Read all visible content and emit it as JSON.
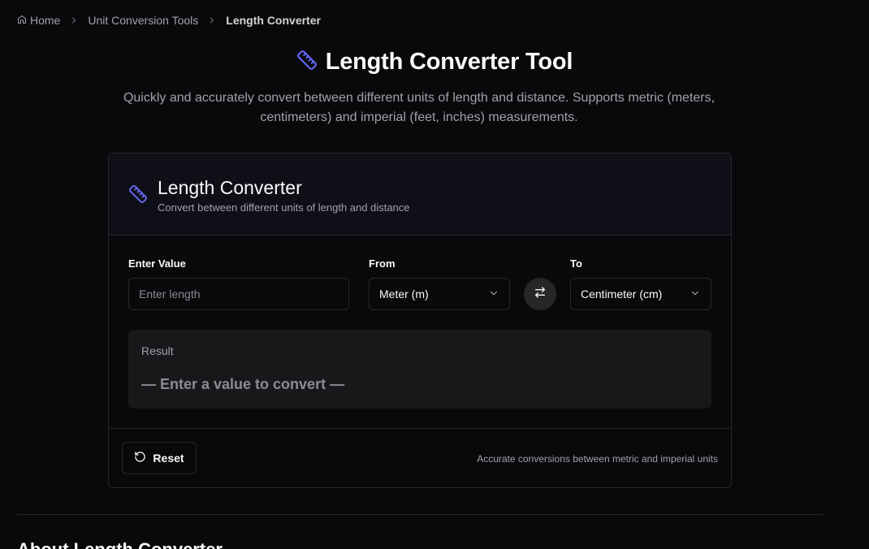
{
  "breadcrumb": {
    "home": "Home",
    "section": "Unit Conversion Tools",
    "current": "Length Converter"
  },
  "hero": {
    "title": "Length Converter Tool",
    "description": "Quickly and accurately convert between different units of length and distance. Supports metric (meters, centimeters) and imperial (feet, inches) measurements."
  },
  "card": {
    "title": "Length Converter",
    "subtitle": "Convert between different units of length and distance",
    "value_label": "Enter Value",
    "value_placeholder": "Enter length",
    "value_input": "",
    "from_label": "From",
    "from_selected": "Meter (m)",
    "to_label": "To",
    "to_selected": "Centimeter (cm)",
    "result_label": "Result",
    "result_value": "— Enter a value to convert —",
    "reset_label": "Reset",
    "footer_note": "Accurate conversions between metric and imperial units"
  },
  "about": {
    "heading": "About Length Converter"
  },
  "icons": {
    "home": "home-icon",
    "separator": "chevron-right-icon",
    "ruler": "ruler-icon",
    "dropdown": "chevron-down-icon",
    "swap": "swap-arrows-icon",
    "reset": "rotate-ccw-icon"
  },
  "colors": {
    "background": "#09090b",
    "card_header": "#0f0f17",
    "border": "#27272a",
    "accent": "#6366f1",
    "muted_text": "#a1a1aa",
    "result_bg": "#18181b"
  }
}
